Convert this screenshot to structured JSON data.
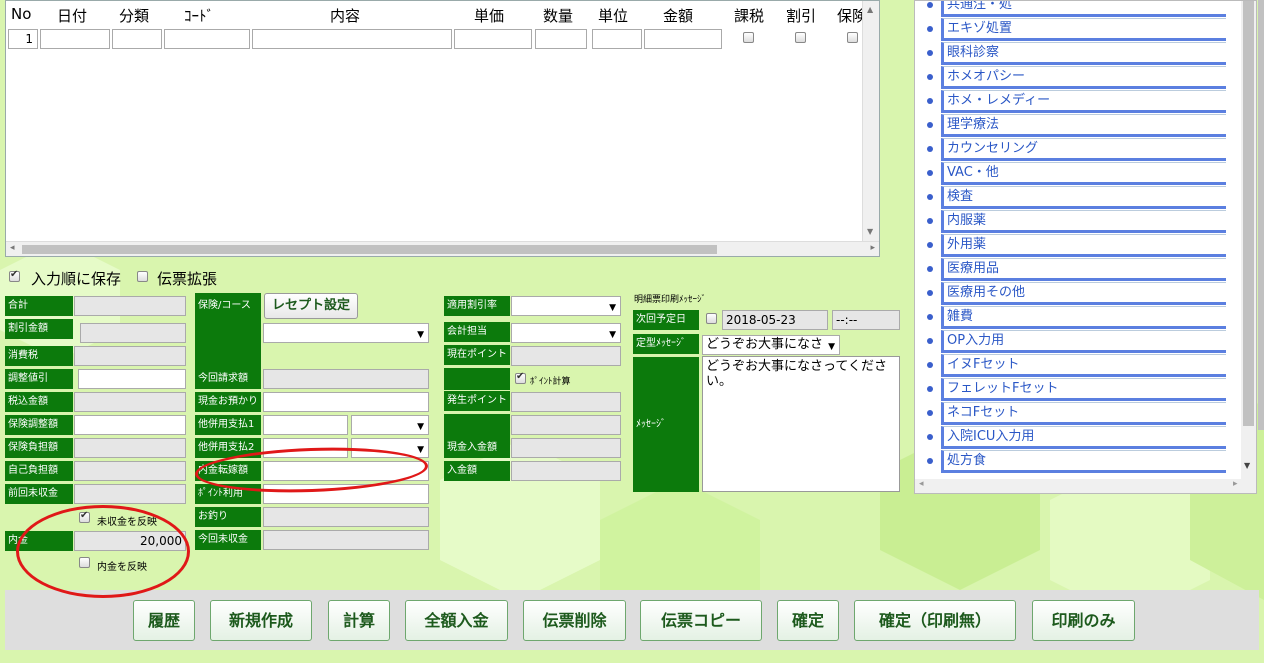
{
  "grid": {
    "headers": [
      "No",
      "日付",
      "分類",
      "ｺｰﾄﾞ",
      "内容",
      "単価",
      "数量",
      "単位",
      "金額",
      "課税",
      "割引",
      "保険"
    ],
    "row_no": "1"
  },
  "options": {
    "save_in_order": "入力順に保存",
    "expand_slip": "伝票拡張"
  },
  "left_form": {
    "labels": [
      "合計",
      "割引金額",
      "消費税",
      "調整値引",
      "税込金額",
      "保険調整額",
      "保険負担額",
      "自己負担額",
      "前回未収金"
    ],
    "reflect_unpaid": "未収金を反映",
    "uchikin_label": "内金",
    "uchikin_value": "20,000",
    "reflect_uchikin": "内金を反映"
  },
  "mid_form": {
    "insurance_course": "保険/コース",
    "receipt_setting": "レセプト設定",
    "labels": [
      "今回請求額",
      "現金お預かり",
      "他併用支払1",
      "他併用支払2",
      "内金転嫁額",
      "ﾎﾟｲﾝﾄ利用",
      "お釣り",
      "今回未収金"
    ]
  },
  "third_form": {
    "labels": [
      "適用割引率",
      "会計担当",
      "現在ポイント",
      "発生ポイント",
      "現金入金額",
      "入金額"
    ],
    "point_calc": "ﾎﾟｲﾝﾄ計算"
  },
  "message_form": {
    "heading": "明細票印刷ﾒｯｾｰｼﾞ",
    "next_date_label": "次回予定日",
    "next_date": "2018-05-23",
    "next_time": "--:--",
    "template_label": "定型ﾒｯｾｰｼﾞ",
    "template_value": "どうぞお大事になさ",
    "message_label": "ﾒｯｾｰｼﾞ",
    "message_text": "どうぞお大事になさってください。"
  },
  "right_list": [
    "共通注・処",
    "エキゾ処置",
    "眼科診察",
    "ホメオパシー",
    "ホメ・レメディー",
    "理学療法",
    "カウンセリング",
    "VAC・他",
    "検査",
    "内服薬",
    "外用薬",
    "医療用品",
    "医療用その他",
    "雑費",
    "OP入力用",
    "イヌFセット",
    "フェレットFセット",
    "ネコFセット",
    "入院ICU入力用",
    "処方食"
  ],
  "toolbar": [
    "履歴",
    "新規作成",
    "計算",
    "全額入金",
    "伝票削除",
    "伝票コピー",
    "確定",
    "確定（印刷無）",
    "印刷のみ"
  ],
  "colors": {
    "label_green": "#0c7a0c",
    "annotation_red": "#e01818",
    "list_blue": "#2a57c6"
  }
}
